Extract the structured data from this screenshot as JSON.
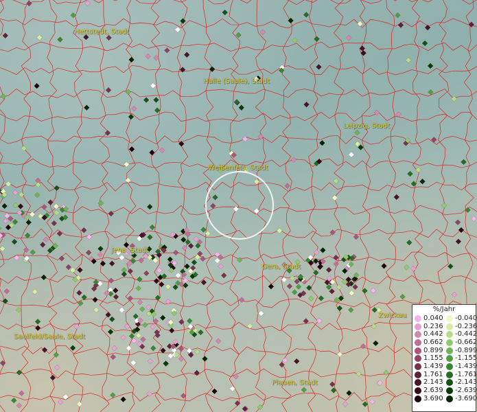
{
  "cities": [
    {
      "id": "hettstedt",
      "label": "Hettstedt, Stadt"
    },
    {
      "id": "halle",
      "label": "Halle (Saale), Stadt"
    },
    {
      "id": "leipzig",
      "label": "Leipzig, Stadt"
    },
    {
      "id": "weissenfels",
      "label": "Weißenfels, Stadt"
    },
    {
      "id": "jena",
      "label": "Jena, Stadt"
    },
    {
      "id": "gera",
      "label": "Gera, Stadt"
    },
    {
      "id": "zwickau",
      "label": "Zwickau"
    },
    {
      "id": "saalfeld",
      "label": "Saalfeld/Saale, Stadt"
    },
    {
      "id": "plauen",
      "label": "Plauen, Stadt"
    }
  ],
  "legend": {
    "unit": "%/Jahr",
    "positive": [
      {
        "value": "0.040",
        "color": "#f4b4ec"
      },
      {
        "value": "0.236",
        "color": "#e6a2d0"
      },
      {
        "value": "0.442",
        "color": "#d488b0"
      },
      {
        "value": "0.662",
        "color": "#c06e95"
      },
      {
        "value": "0.899",
        "color": "#a8567a"
      },
      {
        "value": "1.155",
        "color": "#904464"
      },
      {
        "value": "1.439",
        "color": "#78324e"
      },
      {
        "value": "1.761",
        "color": "#60223a"
      },
      {
        "value": "2.143",
        "color": "#481428"
      },
      {
        "value": "2.639",
        "color": "#320a18"
      },
      {
        "value": "3.690",
        "color": "#1c020a"
      }
    ],
    "negative": [
      {
        "value": "-0.040",
        "color": "#f4f8c8"
      },
      {
        "value": "-0.236",
        "color": "#d8eca8"
      },
      {
        "value": "-0.442",
        "color": "#b6dc8a"
      },
      {
        "value": "-0.662",
        "color": "#92c870"
      },
      {
        "value": "-0.899",
        "color": "#70b45a"
      },
      {
        "value": "-1.155",
        "color": "#529e46"
      },
      {
        "value": "-1.439",
        "color": "#3a8634"
      },
      {
        "value": "-1.761",
        "color": "#266c24"
      },
      {
        "value": "-2.143",
        "color": "#165218"
      },
      {
        "value": "-2.639",
        "color": "#0a3a0c"
      },
      {
        "value": "-3.690",
        "color": "#022402"
      }
    ]
  },
  "colors": {
    "boundary": "#e02020",
    "label": "#e6d21c",
    "selection_ring": "#ffffff"
  }
}
